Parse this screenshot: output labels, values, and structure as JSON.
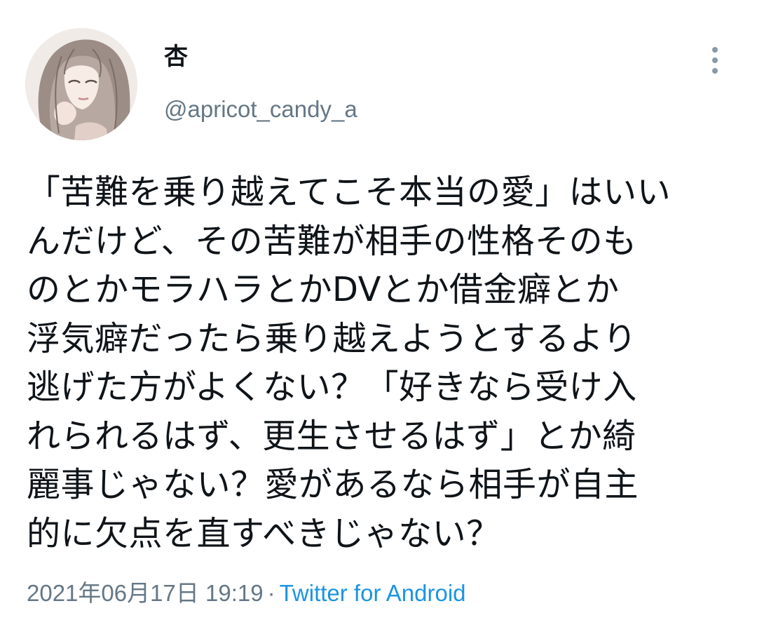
{
  "user": {
    "display_name": "杏",
    "handle": "@apricot_candy_a"
  },
  "tweet": {
    "lines": [
      "「苦難を乗り越えてこそ本当の愛」はいい",
      "んだけど、その苦難が相手の性格そのも",
      "のとかモラハラとかDVとか借金癖とか",
      "浮気癖だったら乗り越えようとするより",
      "逃げた方がよくない？「好きなら受け入",
      "れられるはず、更生させるはず」とか綺",
      "麗事じゃない？愛があるなら相手が自主",
      "的に欠点を直すべきじゃない？"
    ]
  },
  "meta": {
    "timestamp": "2021年06月17日 19:19",
    "separator": "·",
    "source": "Twitter for Android"
  },
  "icons": {
    "more": "more-vertical-icon"
  },
  "colors": {
    "text": "#0f1419",
    "secondary": "#657786",
    "link": "#1b95e0",
    "icon": "#8899a6"
  }
}
